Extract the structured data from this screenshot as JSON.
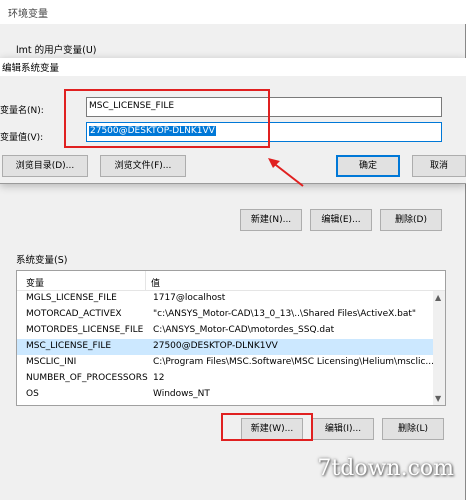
{
  "bg_window": {
    "title": "环境变量",
    "user_vars_label": "lmt 的用户变量(U)",
    "user_buttons": {
      "new": "新建(N)...",
      "edit": "编辑(E)...",
      "delete": "删除(D)"
    },
    "system_vars_label": "系统变量(S)",
    "system_table": {
      "columns": [
        "变量",
        "值"
      ],
      "rows": [
        {
          "var": "MGLS_LICENSE_FILE",
          "val": "1717@localhost"
        },
        {
          "var": "MOTORCAD_ACTIVEX",
          "val": "\"c:\\ANSYS_Motor-CAD\\13_0_13\\..\\Shared Files\\ActiveX.bat\""
        },
        {
          "var": "MOTORDES_LICENSE_FILE",
          "val": "C:\\ANSYS_Motor-CAD\\motordes_SSQ.dat"
        },
        {
          "var": "MSC_LICENSE_FILE",
          "val": "27500@DESKTOP-DLNK1VV",
          "selected": true
        },
        {
          "var": "MSCLIC_INI",
          "val": "C:\\Program Files\\MSC.Software\\MSC Licensing\\Helium\\msclic..."
        },
        {
          "var": "NUMBER_OF_PROCESSORS",
          "val": "12"
        },
        {
          "var": "OS",
          "val": "Windows_NT"
        }
      ]
    },
    "system_buttons": {
      "new": "新建(W)...",
      "edit": "编辑(I)...",
      "delete": "删除(L)"
    }
  },
  "edit_dialog": {
    "title": "编辑系统变量",
    "name_label": "变量名(N):",
    "value_label": "变量值(V):",
    "name_value": "MSC_LICENSE_FILE",
    "value_value": "27500@DESKTOP-DLNK1VV",
    "browse_dir": "浏览目录(D)...",
    "browse_file": "浏览文件(F)...",
    "ok": "确定",
    "cancel": "取消"
  },
  "annotations": {
    "highlight_color": "#e02020"
  },
  "watermark": "7tdown.com",
  "colors": {
    "accent": "#0078d7",
    "selection_row": "#cce8ff"
  }
}
